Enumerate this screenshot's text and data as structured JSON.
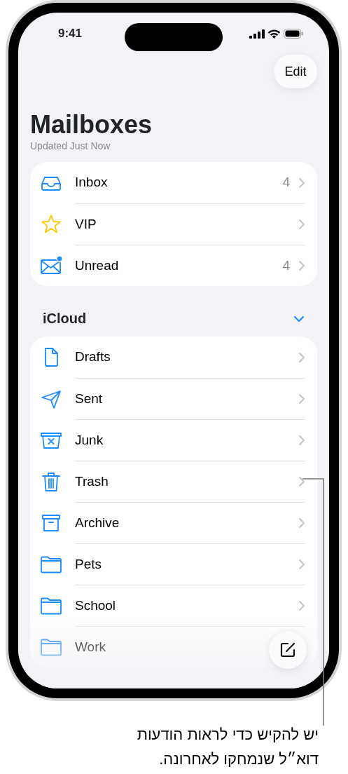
{
  "status_bar": {
    "time": "9:41"
  },
  "edit_button": {
    "label": "Edit"
  },
  "title": "Mailboxes",
  "subtitle": "Updated Just Now",
  "mailboxes": [
    {
      "kind": "inbox",
      "name": "Inbox",
      "count": "4"
    },
    {
      "kind": "star",
      "name": "VIP"
    },
    {
      "kind": "unread",
      "name": "Unread",
      "count": "4"
    }
  ],
  "account": {
    "name": "iCloud",
    "expanded": true
  },
  "folders": [
    {
      "kind": "drafts",
      "name": "Drafts"
    },
    {
      "kind": "sent",
      "name": "Sent"
    },
    {
      "kind": "junk",
      "name": "Junk"
    },
    {
      "kind": "trash",
      "name": "Trash"
    },
    {
      "kind": "archive",
      "name": "Archive"
    },
    {
      "kind": "folder",
      "name": "Pets"
    },
    {
      "kind": "folder",
      "name": "School"
    },
    {
      "kind": "folder",
      "name": "Work"
    }
  ],
  "callout": "יש להקיש כדי לראות הודעות דוא״ל שנמחקו לאחרונה."
}
